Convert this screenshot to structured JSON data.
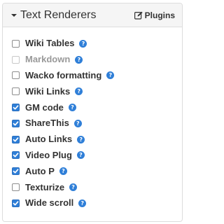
{
  "panel": {
    "title": "Text Renderers",
    "plugins_label": "Plugins",
    "icons": {
      "caret": "caret-down-icon",
      "plugins": "edit-icon",
      "help": "question-circle-icon"
    },
    "colors": {
      "accent": "#2f7fd8",
      "header_bg": "#f5f5f5",
      "disabled_text": "#999999"
    },
    "help_glyph": "?"
  },
  "renderers": [
    {
      "label": "Wiki Tables",
      "checked": false,
      "disabled": false
    },
    {
      "label": "Markdown",
      "checked": false,
      "disabled": true
    },
    {
      "label": "Wacko formatting",
      "checked": false,
      "disabled": false
    },
    {
      "label": "Wiki Links",
      "checked": false,
      "disabled": false
    },
    {
      "label": "GM code",
      "checked": true,
      "disabled": false
    },
    {
      "label": "ShareThis",
      "checked": true,
      "disabled": false
    },
    {
      "label": "Auto Links",
      "checked": true,
      "disabled": false
    },
    {
      "label": "Video Plug",
      "checked": true,
      "disabled": false
    },
    {
      "label": "Auto P",
      "checked": true,
      "disabled": false
    },
    {
      "label": "Texturize",
      "checked": false,
      "disabled": false
    },
    {
      "label": "Wide scroll",
      "checked": true,
      "disabled": false
    }
  ]
}
